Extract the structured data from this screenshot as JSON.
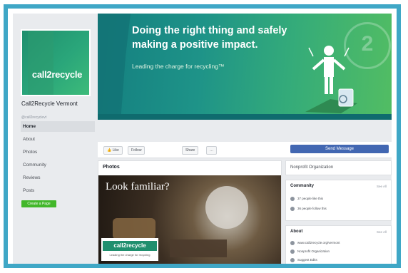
{
  "page": {
    "name": "Call2Recycle Vermont",
    "handle": "@call2recyclevt",
    "profile_logo": "call2recycle"
  },
  "nav": {
    "items": [
      "Home",
      "About",
      "Photos",
      "Community",
      "Reviews",
      "Posts"
    ],
    "create_page": "Create a Page"
  },
  "cover": {
    "headline_line1": "Doing the right thing and safely",
    "headline_line2": "making a positive impact.",
    "tagline": "Leading the charge for recycling™",
    "watermark": "2"
  },
  "actions": {
    "like": "Like",
    "follow": "Follow",
    "share": "Share",
    "more": "…",
    "send_message": "Send Message"
  },
  "photos": {
    "title": "Photos",
    "photo_caption": "Look familiar?",
    "logo_text": "call2recycle",
    "logo_sub": "Leading the charge for recycling"
  },
  "sidebar": {
    "category": "Nonprofit Organization",
    "community": {
      "title": "Community",
      "see_all": "See All",
      "likes": "37 people like this",
      "follows": "36 people follow this"
    },
    "about": {
      "title": "About",
      "see_all": "See All",
      "website": "www.call2recycle.org/vermont",
      "category": "Nonprofit Organization",
      "edits": "Suggest Edits"
    }
  }
}
